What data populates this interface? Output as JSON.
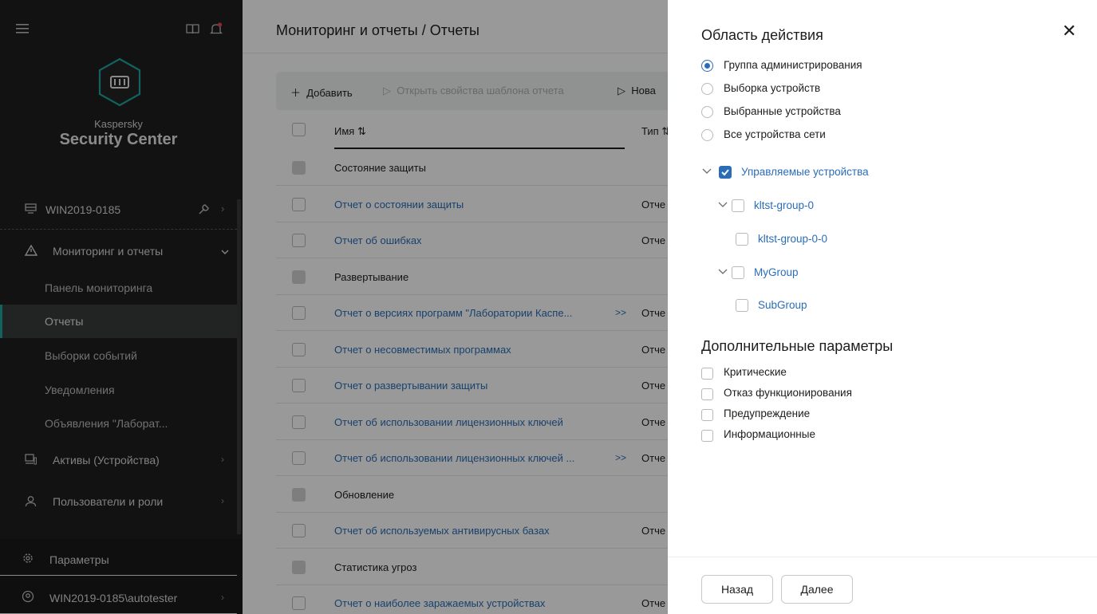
{
  "sidebar": {
    "brand_line1": "Kaspersky",
    "brand_line2": "Security Center",
    "server": "WIN2019-0185",
    "monitoring": "Мониторинг и отчеты",
    "sub_items": [
      "Панель мониторинга",
      "Отчеты",
      "Выборки событий",
      "Уведомления",
      "Объявления \"Лаборат..."
    ],
    "assets": "Активы (Устройства)",
    "users": "Пользователи и роли",
    "settings": "Параметры",
    "account": "WIN2019-0185\\autotester"
  },
  "main": {
    "breadcrumb": "Мониторинг и отчеты  /  Отчеты",
    "toolbar": {
      "add": "Добавить",
      "open_props": "Открыть свойства шаблона отчета",
      "new": "Нова"
    },
    "columns": {
      "name": "Имя",
      "type": "Тип"
    },
    "rows": [
      {
        "name": "Состояние защиты",
        "group": true,
        "type": ""
      },
      {
        "name": "Отчет о состоянии защиты",
        "group": false,
        "type": "Отче"
      },
      {
        "name": "Отчет об ошибках",
        "group": false,
        "type": "Отче"
      },
      {
        "name": "Развертывание",
        "group": true,
        "type": ""
      },
      {
        "name": "Отчет о версиях программ \"Лаборатории Каспе...",
        "group": false,
        "type": "Отче",
        "more": ">>"
      },
      {
        "name": "Отчет о несовместимых программах",
        "group": false,
        "type": "Отче"
      },
      {
        "name": "Отчет о развертывании защиты",
        "group": false,
        "type": "Отче"
      },
      {
        "name": "Отчет об использовании лицензионных ключей",
        "group": false,
        "type": "Отче"
      },
      {
        "name": "Отчет об использовании лицензионных ключей ...",
        "group": false,
        "type": "Отче",
        "more": ">>"
      },
      {
        "name": "Обновление",
        "group": true,
        "type": ""
      },
      {
        "name": "Отчет об используемых антивирусных базах",
        "group": false,
        "type": "Отче"
      },
      {
        "name": "Статистика угроз",
        "group": true,
        "type": ""
      },
      {
        "name": "Отчет о наиболее заражаемых устройствах",
        "group": false,
        "type": "Отче"
      }
    ]
  },
  "panel": {
    "scope_title": "Область действия",
    "scope_options": [
      {
        "label": "Группа администрирования",
        "selected": true
      },
      {
        "label": "Выборка устройств",
        "selected": false
      },
      {
        "label": "Выбранные устройства",
        "selected": false
      },
      {
        "label": "Все устройства сети",
        "selected": false
      }
    ],
    "tree": [
      {
        "label": "Управляемые устройства",
        "checked": true
      },
      {
        "label": "kltst-group-0",
        "checked": false
      },
      {
        "label": "kltst-group-0-0",
        "checked": false
      },
      {
        "label": "MyGroup",
        "checked": false
      },
      {
        "label": "SubGroup",
        "checked": false
      }
    ],
    "extra_title": "Дополнительные параметры",
    "extra_options": [
      "Критические",
      "Отказ функционирования",
      "Предупреждение",
      "Информационные"
    ],
    "back": "Назад",
    "next": "Далее"
  },
  "colors": {
    "accent": "#2a6db6",
    "teal": "#1ea5a0",
    "sidebar_bg": "#1e1f1f"
  }
}
